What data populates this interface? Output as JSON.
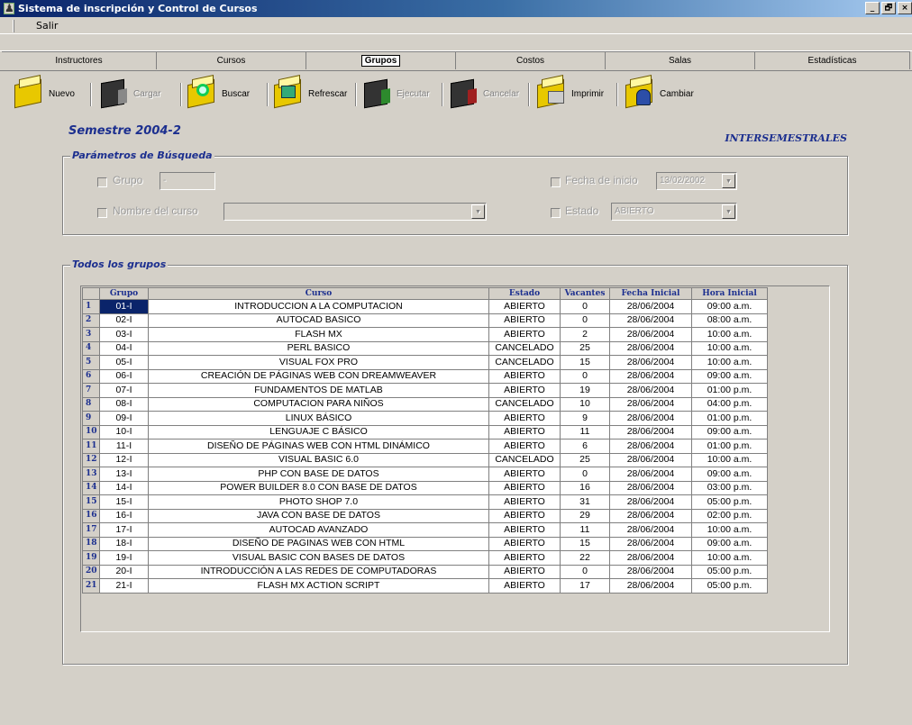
{
  "window": {
    "title": "Sistema de inscripción y Control de Cursos",
    "controls": [
      "_",
      "🗗",
      "×"
    ]
  },
  "menu": {
    "items": [
      "Salir"
    ]
  },
  "tabs": [
    {
      "label": "Instructores",
      "active": false
    },
    {
      "label": "Cursos",
      "active": false
    },
    {
      "label": "Grupos",
      "active": true
    },
    {
      "label": "Costos",
      "active": false
    },
    {
      "label": "Salas",
      "active": false
    },
    {
      "label": "Estadísticas",
      "active": false
    }
  ],
  "toolbar": {
    "nuevo": "Nuevo",
    "cargar": "Cargar",
    "buscar": "Buscar",
    "refrescar": "Refrescar",
    "ejecutar": "Ejecutar",
    "cancelar": "Cancelar",
    "imprimir": "Imprimir",
    "cambiar": "Cambiar"
  },
  "semestre": "Semestre 2004-2",
  "intersemestrales": "INTERSEMESTRALES",
  "search": {
    "legend": "Parámetros de Búsqueda",
    "grupo_label": "Grupo",
    "grupo_value": "-",
    "nombre_label": "Nombre del curso",
    "nombre_value": "",
    "fecha_label": "Fecha de inicio",
    "fecha_value": "13/02/2002",
    "estado_label": "Estado",
    "estado_value": "ABIERTO"
  },
  "grid": {
    "legend": "Todos los grupos",
    "columns": [
      "Grupo",
      "Curso",
      "Estado",
      "Vacantes",
      "Fecha Inicial",
      "Hora Inicial"
    ],
    "rows": [
      [
        "01-I",
        "INTRODUCCION A LA COMPUTACION",
        "ABIERTO",
        "0",
        "28/06/2004",
        "09:00 a.m."
      ],
      [
        "02-I",
        "AUTOCAD BASICO",
        "ABIERTO",
        "0",
        "28/06/2004",
        "08:00 a.m."
      ],
      [
        "03-I",
        "FLASH MX",
        "ABIERTO",
        "2",
        "28/06/2004",
        "10:00 a.m."
      ],
      [
        "04-I",
        "PERL BASICO",
        "CANCELADO",
        "25",
        "28/06/2004",
        "10:00 a.m."
      ],
      [
        "05-I",
        "VISUAL FOX PRO",
        "CANCELADO",
        "15",
        "28/06/2004",
        "10:00 a.m."
      ],
      [
        "06-I",
        "CREACIÓN DE PÁGINAS WEB CON DREAMWEAVER",
        "ABIERTO",
        "0",
        "28/06/2004",
        "09:00 a.m."
      ],
      [
        "07-I",
        "FUNDAMENTOS DE MATLAB",
        "ABIERTO",
        "19",
        "28/06/2004",
        "01:00 p.m."
      ],
      [
        "08-I",
        "COMPUTACION PARA NIÑOS",
        "CANCELADO",
        "10",
        "28/06/2004",
        "04:00 p.m."
      ],
      [
        "09-I",
        "LINUX BÁSICO",
        "ABIERTO",
        "9",
        "28/06/2004",
        "01:00 p.m."
      ],
      [
        "10-I",
        "LENGUAJE C BÁSICO",
        "ABIERTO",
        "11",
        "28/06/2004",
        "09:00 a.m."
      ],
      [
        "11-I",
        "DISEÑO DE PÁGINAS WEB CON HTML DINÁMICO",
        "ABIERTO",
        "6",
        "28/06/2004",
        "01:00 p.m."
      ],
      [
        "12-I",
        "VISUAL BASIC 6.0",
        "CANCELADO",
        "25",
        "28/06/2004",
        "10:00 a.m."
      ],
      [
        "13-I",
        "PHP CON BASE DE DATOS",
        "ABIERTO",
        "0",
        "28/06/2004",
        "09:00 a.m."
      ],
      [
        "14-I",
        "POWER BUILDER 8.0 CON BASE DE DATOS",
        "ABIERTO",
        "16",
        "28/06/2004",
        "03:00 p.m."
      ],
      [
        "15-I",
        "PHOTO SHOP 7.0",
        "ABIERTO",
        "31",
        "28/06/2004",
        "05:00 p.m."
      ],
      [
        "16-I",
        "JAVA CON BASE DE DATOS",
        "ABIERTO",
        "29",
        "28/06/2004",
        "02:00 p.m."
      ],
      [
        "17-I",
        "AUTOCAD AVANZADO",
        "ABIERTO",
        "11",
        "28/06/2004",
        "10:00 a.m."
      ],
      [
        "18-I",
        "DISEÑO DE PAGINAS WEB CON HTML",
        "ABIERTO",
        "15",
        "28/06/2004",
        "09:00 a.m."
      ],
      [
        "19-I",
        "VISUAL BASIC CON BASES DE DATOS",
        "ABIERTO",
        "22",
        "28/06/2004",
        "10:00 a.m."
      ],
      [
        "20-I",
        "INTRODUCCIÓN A LAS REDES DE COMPUTADORAS",
        "ABIERTO",
        "0",
        "28/06/2004",
        "05:00 p.m."
      ],
      [
        "21-I",
        "FLASH MX ACTION SCRIPT",
        "ABIERTO",
        "17",
        "28/06/2004",
        "05:00 p.m."
      ]
    ]
  },
  "colors": {
    "accent": "#1c2f8f",
    "title_bar": "#0a246a",
    "face": "#d4d0c8"
  }
}
